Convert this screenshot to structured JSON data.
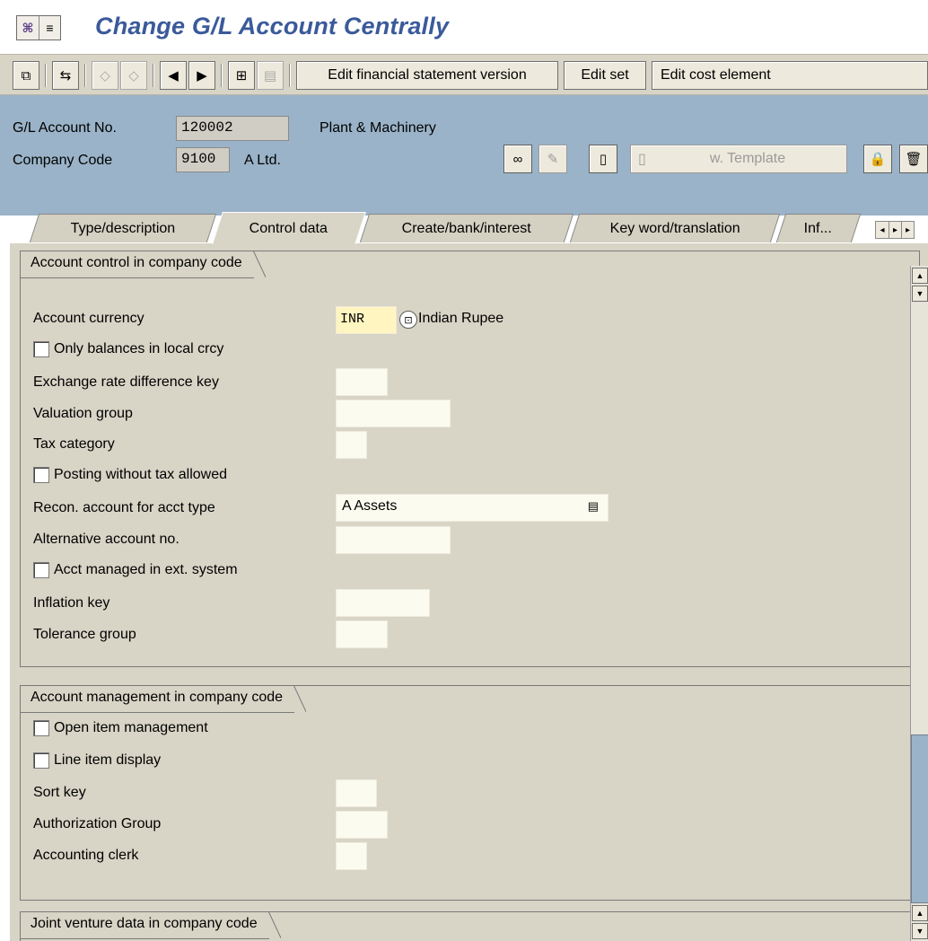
{
  "title": {
    "text": "Change G/L Account Centrally",
    "icons": [
      "transaction-icon",
      "menu-icon"
    ]
  },
  "toolbar": {
    "buttons_text": {
      "edit_fs_version": "Edit financial statement version",
      "edit_set": "Edit set",
      "edit_cost_element": "Edit cost element"
    }
  },
  "header": {
    "gl_account_label": "G/L Account No.",
    "gl_account_value": "120002",
    "gl_account_desc": "Plant & Machinery",
    "company_code_label": "Company Code",
    "company_code_value": "9100",
    "company_code_desc": "A Ltd.",
    "template_button": "w. Template"
  },
  "tabs": [
    {
      "label": "Type/description",
      "active": false
    },
    {
      "label": "Control data",
      "active": true
    },
    {
      "label": "Create/bank/interest",
      "active": false
    },
    {
      "label": "Key word/translation",
      "active": false
    },
    {
      "label": "Inf...",
      "active": false
    }
  ],
  "group1": {
    "title": "Account control in company code",
    "account_currency_label": "Account currency",
    "account_currency_value": "INR",
    "account_currency_desc": "Indian Rupee",
    "only_balances_label": "Only balances in local crcy",
    "exch_rate_label": "Exchange rate difference key",
    "valuation_group_label": "Valuation group",
    "tax_category_label": "Tax category",
    "posting_wo_tax_label": "Posting without tax allowed",
    "recon_label": "Recon. account for acct type",
    "recon_value": "A Assets",
    "alt_account_label": "Alternative account no.",
    "acct_managed_label": "Acct managed in ext. system",
    "inflation_key_label": "Inflation key",
    "tolerance_group_label": "Tolerance group"
  },
  "group2": {
    "title": "Account management in company code",
    "open_item_label": "Open item management",
    "line_item_label": "Line item display",
    "sort_key_label": "Sort key",
    "auth_group_label": "Authorization Group",
    "accounting_clerk_label": "Accounting clerk"
  },
  "group3": {
    "title": "Joint venture data in company code"
  },
  "colors": {
    "title_blue": "#3a5a9a",
    "header_bg": "#9ab3c8",
    "panel_bg": "#d8d4c6",
    "input_bg": "#fbfbef",
    "focus_bg": "#fff5c0"
  }
}
